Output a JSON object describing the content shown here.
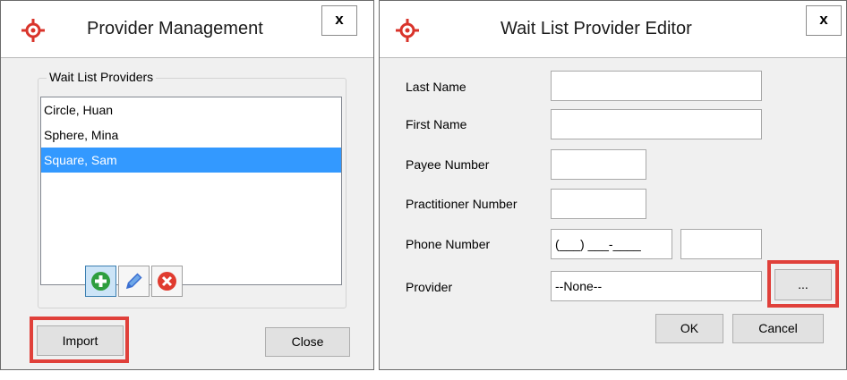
{
  "colors": {
    "selection": "#3399ff",
    "highlight": "#e0403a",
    "brand": "#d9342b",
    "add_green": "#2e9e3e",
    "edit_blue": "#3b6fd1",
    "delete_red": "#e03b2f"
  },
  "provider_management": {
    "title": "Provider Management",
    "close_label": "x",
    "app_icon": "crosshair-target-icon",
    "group_label": "Wait List Providers",
    "providers": [
      {
        "name": "Circle, Huan",
        "selected": false
      },
      {
        "name": "Sphere, Mina",
        "selected": false
      },
      {
        "name": "Square, Sam",
        "selected": true
      }
    ],
    "toolbar": {
      "add_icon": "plus-circle-icon",
      "edit_icon": "pencil-icon",
      "delete_icon": "x-circle-icon"
    },
    "import_label": "Import",
    "close_button_label": "Close"
  },
  "editor": {
    "title": "Wait List Provider Editor",
    "close_label": "x",
    "app_icon": "crosshair-target-icon",
    "fields": {
      "last_name_label": "Last Name",
      "last_name_value": "",
      "first_name_label": "First Name",
      "first_name_value": "",
      "payee_label": "Payee Number",
      "payee_value": "",
      "practitioner_label": "Practitioner Number",
      "practitioner_value": "",
      "phone_label": "Phone Number",
      "phone_value": "(___) ___-____",
      "phone_ext_value": "",
      "provider_label": "Provider",
      "provider_value": "--None--",
      "browse_label": "..."
    },
    "ok_label": "OK",
    "cancel_label": "Cancel"
  }
}
